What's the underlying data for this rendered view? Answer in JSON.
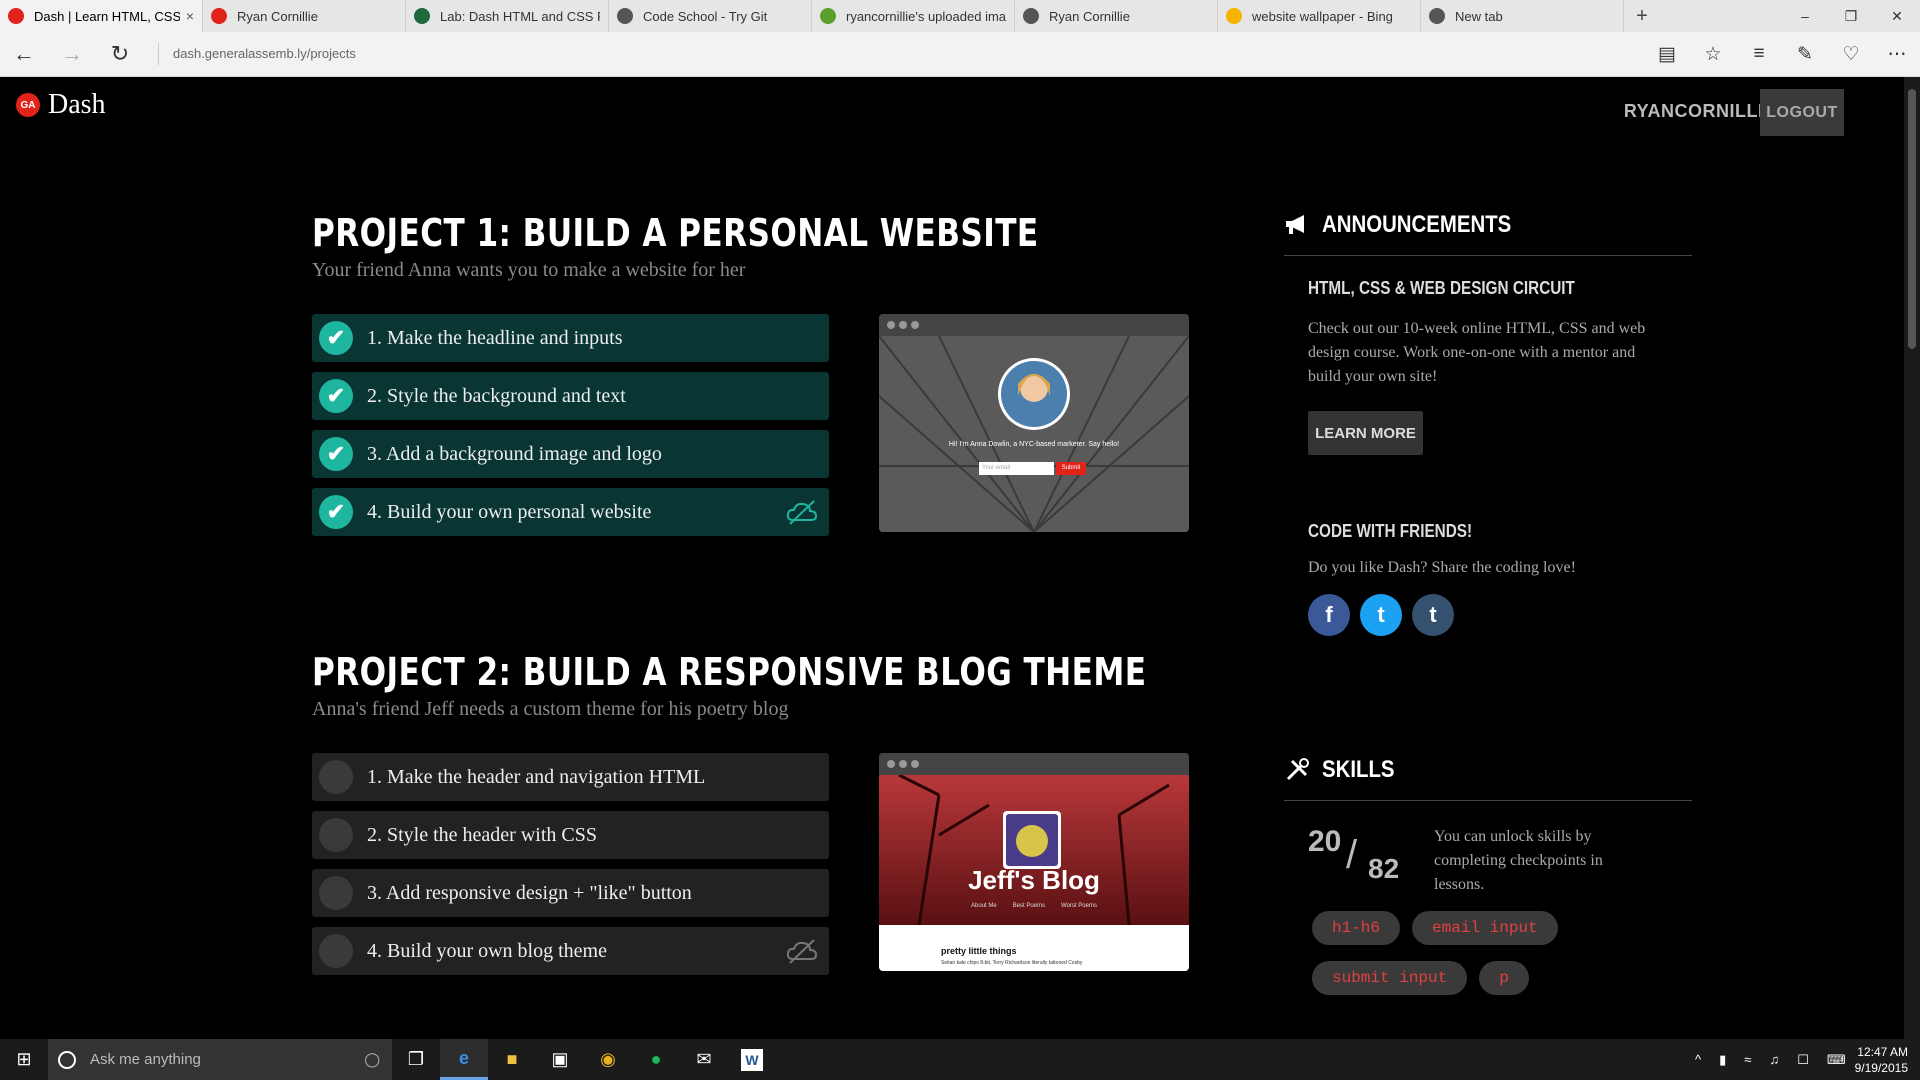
{
  "browser": {
    "tabs": [
      {
        "title": "Dash | Learn HTML, CSS",
        "icon": "ga-icon",
        "color": "#e2231a",
        "active": true
      },
      {
        "title": "Ryan Cornillie",
        "icon": "ga-icon",
        "color": "#e2231a"
      },
      {
        "title": "Lab: Dash HTML and CSS Pr",
        "icon": "s-icon",
        "color": "#1d6b3c"
      },
      {
        "title": "Code School - Try Git",
        "icon": "page-icon",
        "color": "#555"
      },
      {
        "title": "ryancornillie's uploaded ima",
        "icon": "circle-icon",
        "color": "#5aa02c"
      },
      {
        "title": "Ryan Cornillie",
        "icon": "page-icon",
        "color": "#555"
      },
      {
        "title": "website wallpaper - Bing",
        "icon": "bing-icon",
        "color": "#f3b300"
      },
      {
        "title": "New tab",
        "icon": "page-icon",
        "color": "#555"
      }
    ],
    "url_domain": "dash.generalassemb.ly",
    "url_path": "/projects"
  },
  "header": {
    "logo_badge": "GA",
    "brand": "Dash",
    "username": "RYANCORNILLIE",
    "logout_label": "LOGOUT"
  },
  "projects": [
    {
      "title": "PROJECT 1: BUILD A PERSONAL WEBSITE",
      "subtitle": "Your friend Anna wants you to make a website for her",
      "steps": [
        {
          "label": "1. Make the headline and inputs",
          "done": true
        },
        {
          "label": "2. Style the background and text",
          "done": true
        },
        {
          "label": "3. Add a background image and logo",
          "done": true
        },
        {
          "label": "4. Build your own personal website",
          "done": true
        }
      ],
      "preview": {
        "tagline": "Hi! I'm Anna Dowlin, a NYC-based marketer. Say hello!",
        "input_placeholder": "Your email",
        "button": "Submit"
      }
    },
    {
      "title": "PROJECT 2: BUILD A RESPONSIVE BLOG THEME",
      "subtitle": "Anna's friend Jeff needs a custom theme for his poetry blog",
      "steps": [
        {
          "label": "1. Make the header and navigation HTML",
          "done": false
        },
        {
          "label": "2. Style the header with CSS",
          "done": false
        },
        {
          "label": "3. Add responsive design + \"like\" button",
          "done": false
        },
        {
          "label": "4. Build your own blog theme",
          "done": false
        }
      ],
      "preview": {
        "blog_title": "Jeff's Blog",
        "nav": [
          "About Me",
          "Best Poems",
          "Worst Poems"
        ],
        "post_title": "pretty little things",
        "post_text": "Seitan kale chips 8-bit, Terry Richardson literally tattooed Cosby"
      }
    }
  ],
  "announcements": {
    "heading": "ANNOUNCEMENTS",
    "circuit_title": "HTML, CSS & WEB DESIGN CIRCUIT",
    "circuit_text": "Check out our 10-week online HTML, CSS and web design course. Work one-on-one with a mentor and build your own site!",
    "learn_more": "LEARN MORE",
    "friends_title": "CODE WITH FRIENDS!",
    "friends_text": "Do you like Dash? Share the coding love!",
    "social": [
      {
        "name": "facebook",
        "glyph": "f",
        "color": "#3b5998"
      },
      {
        "name": "twitter",
        "glyph": "t",
        "color": "#1da1f2"
      },
      {
        "name": "tumblr",
        "glyph": "t",
        "color": "#34526f"
      }
    ]
  },
  "skills": {
    "heading": "SKILLS",
    "unlocked": "20",
    "total": "82",
    "text": "You can unlock skills by completing checkpoints in lessons.",
    "tags": [
      "h1-h6",
      "email input",
      "submit input",
      "p"
    ]
  },
  "taskbar": {
    "search_placeholder": "Ask me anything",
    "time": "12:47 AM",
    "date": "9/19/2015"
  }
}
